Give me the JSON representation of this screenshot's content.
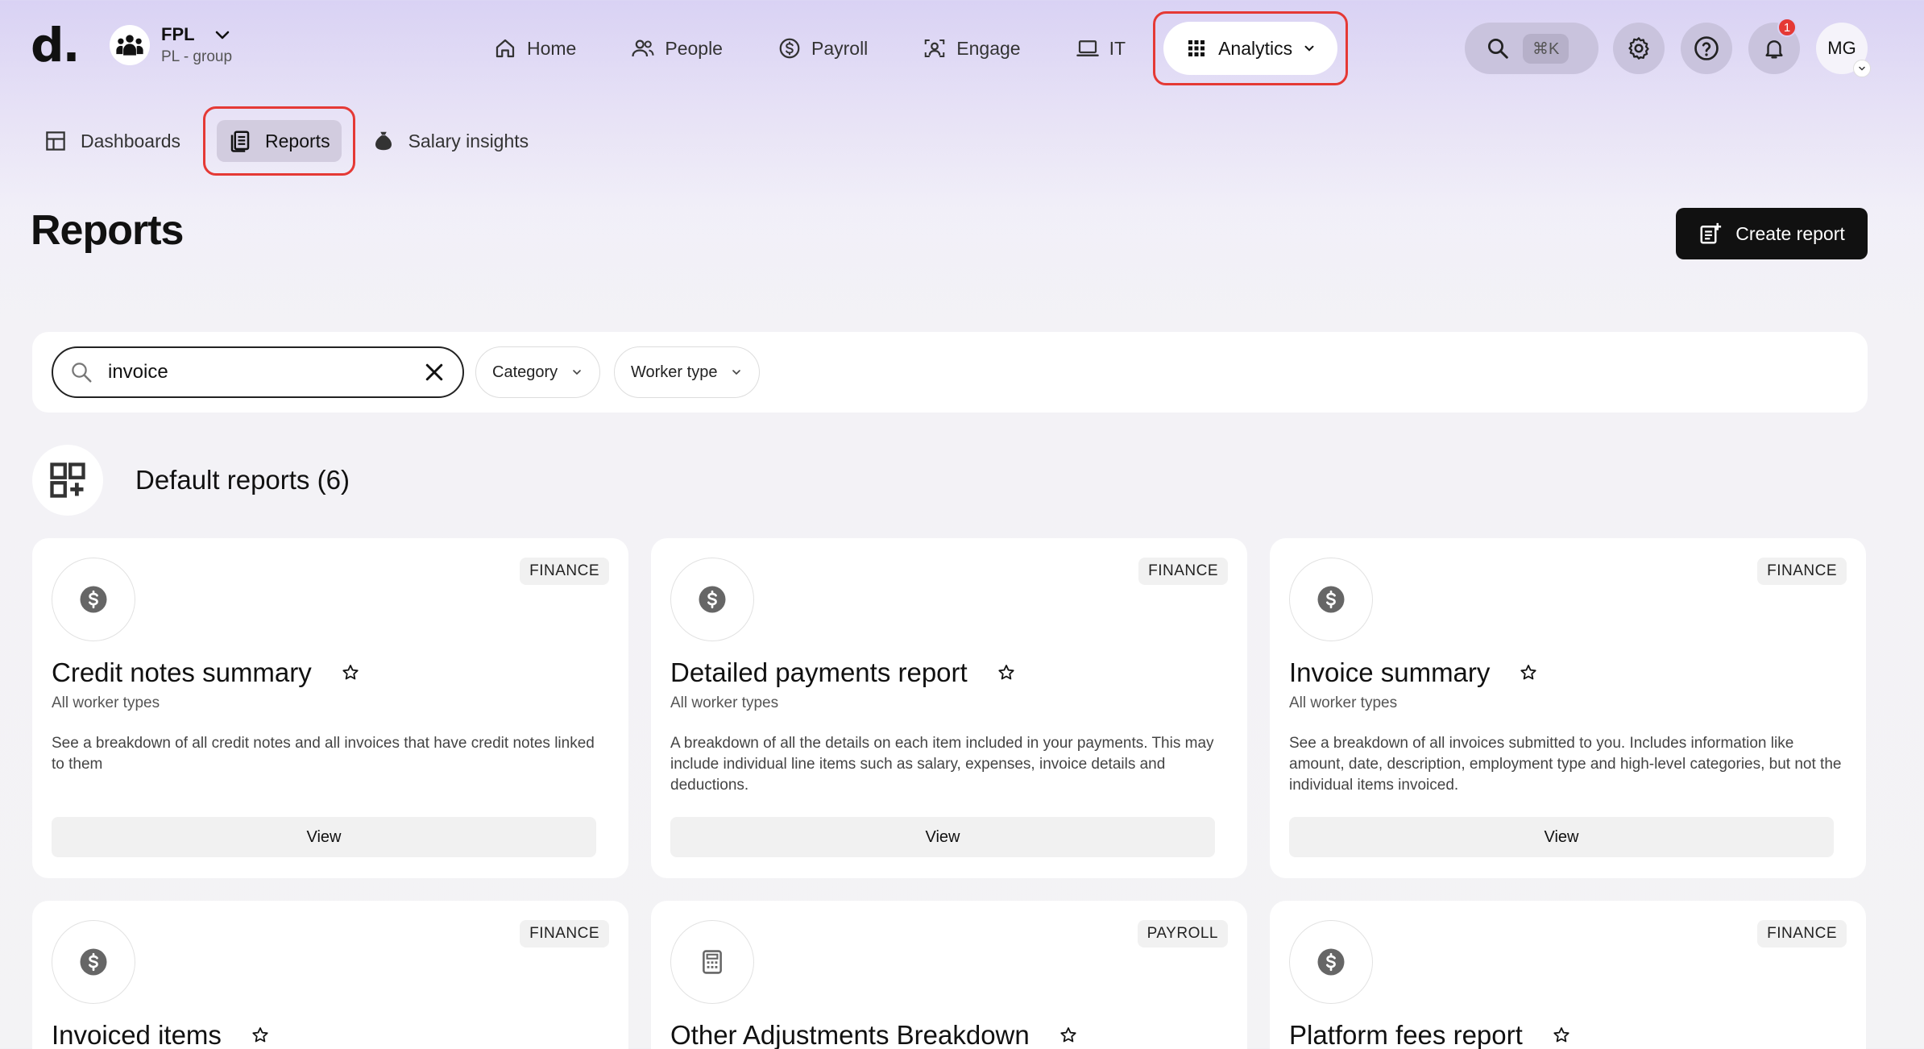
{
  "logo": "d.",
  "org": {
    "name": "FPL",
    "subtitle": "PL - group"
  },
  "nav": {
    "home": "Home",
    "people": "People",
    "payroll": "Payroll",
    "engage": "Engage",
    "it": "IT",
    "analytics": "Analytics"
  },
  "tools": {
    "search_shortcut": "⌘K",
    "notification_count": "1",
    "user_initials": "MG"
  },
  "subnav": {
    "dashboards": "Dashboards",
    "reports": "Reports",
    "salary_insights": "Salary insights"
  },
  "page": {
    "title": "Reports",
    "create_button": "Create report"
  },
  "filters": {
    "search_value": "invoice",
    "category_label": "Category",
    "worker_type_label": "Worker type"
  },
  "section": {
    "title": "Default reports (6)"
  },
  "colors": {
    "highlight": "#e53935",
    "primary_button": "#111111"
  },
  "cards": [
    {
      "tag": "FINANCE",
      "icon": "dollar-icon",
      "title": "Credit notes summary",
      "subtitle": "All worker types",
      "description": "See a breakdown of all credit notes and all invoices that have credit notes linked to them",
      "button": "View"
    },
    {
      "tag": "FINANCE",
      "icon": "dollar-icon",
      "title": "Detailed payments report",
      "subtitle": "All worker types",
      "description": "A breakdown of all the details on each item included in your payments. This may include individual line items such as salary, expenses, invoice details and deductions.",
      "button": "View"
    },
    {
      "tag": "FINANCE",
      "icon": "dollar-icon",
      "title": "Invoice summary",
      "subtitle": "All worker types",
      "description": "See a breakdown of all invoices submitted to you. Includes information like amount, date, description, employment type and high-level categories, but not the individual items invoiced.",
      "button": "View"
    },
    {
      "tag": "FINANCE",
      "icon": "dollar-icon",
      "title": "Invoiced items"
    },
    {
      "tag": "PAYROLL",
      "icon": "calculator-icon",
      "title": "Other Adjustments Breakdown"
    },
    {
      "tag": "FINANCE",
      "icon": "dollar-icon",
      "title": "Platform fees report"
    }
  ]
}
